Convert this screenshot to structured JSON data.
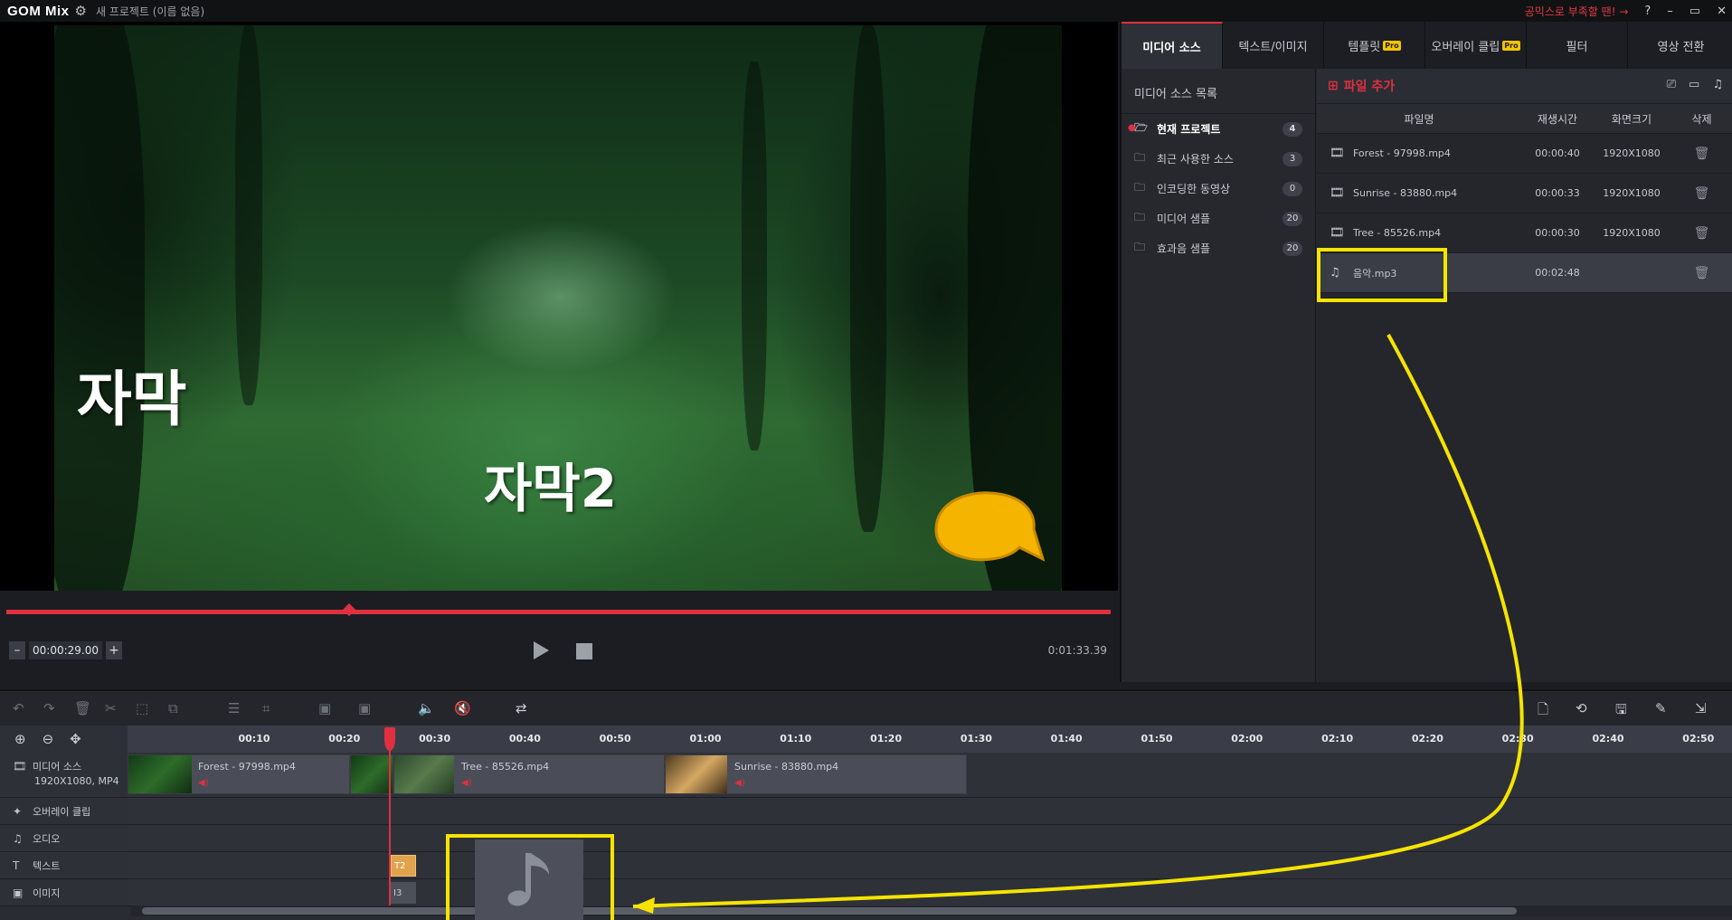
{
  "titlebar": {
    "logo": "GOM Mix",
    "project_title": "새 프로젝트 (이름 없음)",
    "link": "공믹스로 부족할 땐! →",
    "help": "?",
    "minimize": "–",
    "restore": "▭",
    "close": "✕"
  },
  "preview": {
    "caption1": "자막",
    "caption2": "자막2",
    "progress_fraction": 0.31,
    "timecode": "00:00:29.00",
    "duration": "0:01:33.39",
    "minus": "–",
    "plus": "+"
  },
  "tabs": [
    {
      "label": "미디어 소스",
      "active": true,
      "pro": false
    },
    {
      "label": "텍스트/이미지",
      "active": false,
      "pro": false
    },
    {
      "label": "템플릿",
      "active": false,
      "pro": true
    },
    {
      "label": "오버레이 클립",
      "active": false,
      "pro": true
    },
    {
      "label": "필터",
      "active": false,
      "pro": false
    },
    {
      "label": "영상 전환",
      "active": false,
      "pro": false
    }
  ],
  "pro_badge": "Pro",
  "source_list": {
    "title": "미디어 소스 목록",
    "items": [
      {
        "label": "현재 프로젝트",
        "count": "4"
      },
      {
        "label": "최근 사용한 소스",
        "count": "3"
      },
      {
        "label": "인코딩한 동영상",
        "count": "0"
      },
      {
        "label": "미디어 샘플",
        "count": "20"
      },
      {
        "label": "효과음 샘플",
        "count": "20"
      }
    ]
  },
  "files": {
    "add_label": "파일 추가",
    "columns": {
      "name": "파일명",
      "duration": "재생시간",
      "size": "화면크기",
      "delete": "삭제"
    },
    "rows": [
      {
        "name": "Forest - 97998.mp4",
        "duration": "00:00:40",
        "size": "1920X1080",
        "type": "video"
      },
      {
        "name": "Sunrise - 83880.mp4",
        "duration": "00:00:33",
        "size": "1920X1080",
        "type": "video"
      },
      {
        "name": "Tree - 85526.mp4",
        "duration": "00:00:30",
        "size": "1920X1080",
        "type": "video"
      },
      {
        "name": "음악.mp3",
        "duration": "00:02:48",
        "size": "",
        "type": "audio"
      }
    ]
  },
  "timeline": {
    "ticks": [
      "00:10",
      "00:20",
      "00:30",
      "00:40",
      "00:50",
      "01:00",
      "01:10",
      "01:20",
      "01:30",
      "01:40",
      "01:50",
      "02:00",
      "02:10",
      "02:20",
      "02:30",
      "02:40",
      "02:50"
    ],
    "tracks": {
      "media": "미디어 소스",
      "media_sub": "1920X1080, MP4",
      "overlay": "오버레이 클립",
      "audio": "오디오",
      "text": "텍스트",
      "image": "이미지"
    },
    "clips": {
      "forest": "Forest - 97998.mp4",
      "tree": "Tree - 85526.mp4",
      "sunrise": "Sunrise - 83880.mp4"
    },
    "text_clip": "T2",
    "image_clip": "I3"
  },
  "colors": {
    "accent": "#e03040",
    "highlight": "#f5e400",
    "pro_badge": "#f5c400"
  }
}
